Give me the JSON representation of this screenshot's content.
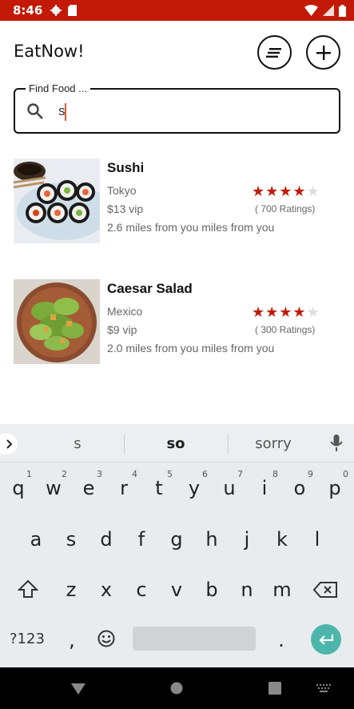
{
  "status_bar": {
    "time": "8:46"
  },
  "header": {
    "title": "EatNow!"
  },
  "search": {
    "legend": "Find Food ...",
    "value": "s"
  },
  "foods": [
    {
      "name": "Sushi",
      "origin": "Tokyo",
      "price": "$13 vip",
      "distance": "2.6 miles from you miles from you",
      "rating": 4,
      "ratings_text": "( 700 Ratings)"
    },
    {
      "name": "Caesar Salad",
      "origin": "Mexico",
      "price": "$9 vip",
      "distance": "2.0 miles from you miles from you",
      "rating": 4,
      "ratings_text": "( 300 Ratings)"
    }
  ],
  "keyboard": {
    "suggestions": [
      "s",
      "so",
      "sorry"
    ],
    "row1": [
      "q",
      "w",
      "e",
      "r",
      "t",
      "y",
      "u",
      "i",
      "o",
      "p"
    ],
    "row1_hints": [
      "1",
      "2",
      "3",
      "4",
      "5",
      "6",
      "7",
      "8",
      "9",
      "0"
    ],
    "row2": [
      "a",
      "s",
      "d",
      "f",
      "g",
      "h",
      "j",
      "k",
      "l"
    ],
    "row3": [
      "z",
      "x",
      "c",
      "v",
      "b",
      "n",
      "m"
    ],
    "symbols_label": "?123",
    "comma": ",",
    "period": "."
  },
  "colors": {
    "brand": "#c21a06",
    "star": "#c21a06",
    "enter": "#4db6ac"
  }
}
